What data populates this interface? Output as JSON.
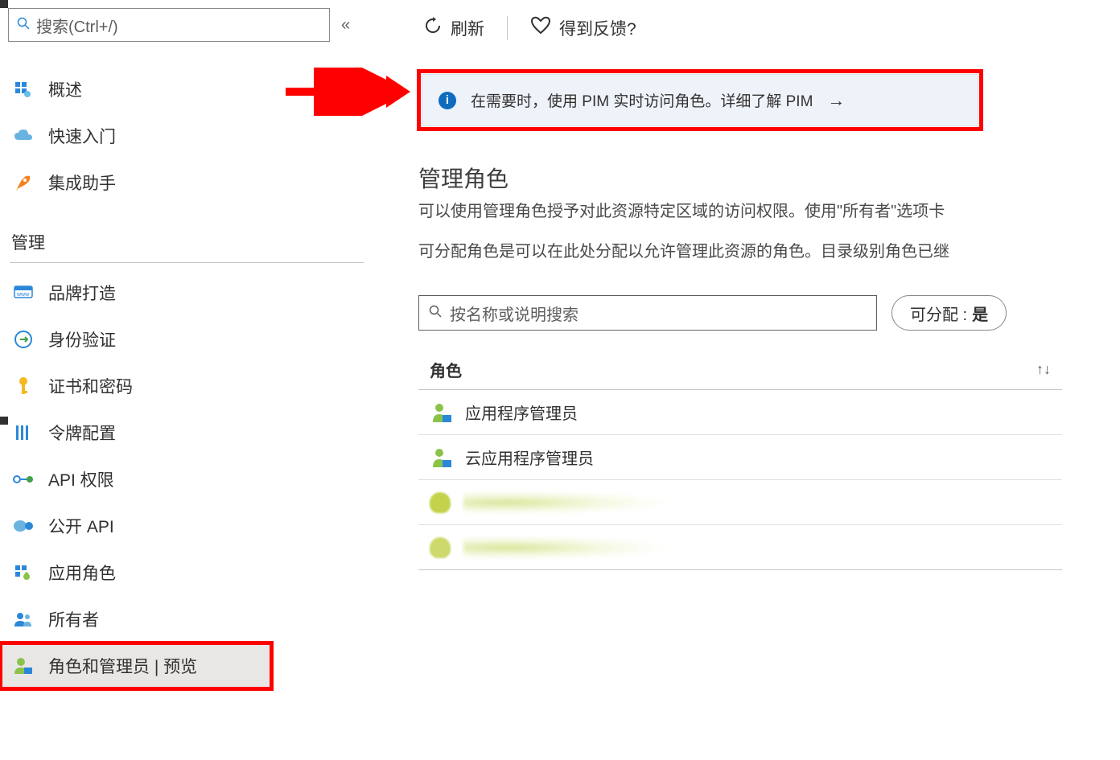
{
  "sidebar": {
    "search_placeholder": "搜索(Ctrl+/)",
    "top_items": [
      {
        "label": "概述"
      },
      {
        "label": "快速入门"
      },
      {
        "label": "集成助手"
      }
    ],
    "section_label": "管理",
    "manage_items": [
      {
        "label": "品牌打造"
      },
      {
        "label": "身份验证"
      },
      {
        "label": "证书和密码"
      },
      {
        "label": "令牌配置"
      },
      {
        "label": "API 权限"
      },
      {
        "label": "公开 API"
      },
      {
        "label": "应用角色"
      },
      {
        "label": "所有者"
      },
      {
        "label": "角色和管理员 | 预览"
      }
    ]
  },
  "toolbar": {
    "refresh_label": "刷新",
    "feedback_label": "得到反馈?"
  },
  "banner": {
    "text": "在需要时，使用 PIM 实时访问角色。详细了解 PIM"
  },
  "section": {
    "title": "管理角色",
    "desc1": "可以使用管理角色授予对此资源特定区域的访问权限。使用\"所有者\"选项卡",
    "desc2": "可分配角色是可以在此处分配以允许管理此资源的角色。目录级别角色已继"
  },
  "filter": {
    "search_placeholder": "按名称或说明搜索",
    "assignable_label": "可分配 : ",
    "assignable_value": "是"
  },
  "table": {
    "header": "角色",
    "rows": [
      {
        "label": "应用程序管理员"
      },
      {
        "label": "云应用程序管理员"
      }
    ]
  }
}
